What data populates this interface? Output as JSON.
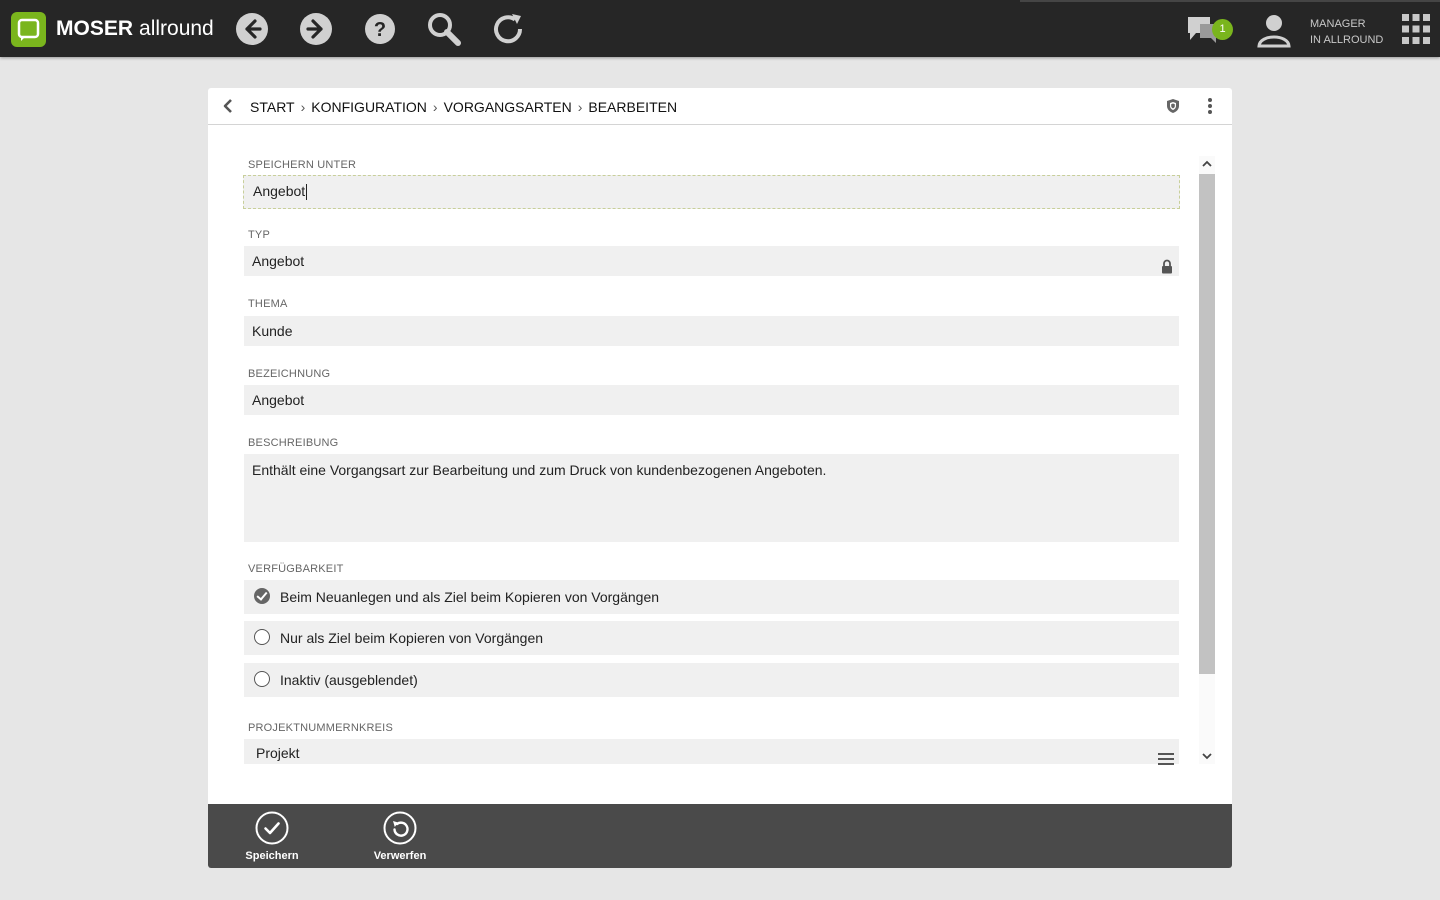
{
  "app": {
    "brand_bold": "MOSER",
    "brand_light": "allround",
    "chat_badge": "1",
    "user_line1": "MANAGER",
    "user_line2": "IN ALLROUND",
    "accent": "#7ab51d"
  },
  "breadcrumb": [
    "START",
    "KONFIGURATION",
    "VORGANGSARTEN",
    "BEARBEITEN"
  ],
  "breadcrumb_sep": "›",
  "form": {
    "speichern_unter": {
      "label": "SPEICHERN UNTER",
      "value": "Angebot"
    },
    "typ": {
      "label": "TYP",
      "value": "Angebot",
      "icon": "lock-icon"
    },
    "thema": {
      "label": "THEMA",
      "value": "Kunde"
    },
    "bezeichnung": {
      "label": "BEZEICHNUNG",
      "value": "Angebot"
    },
    "beschreibung": {
      "label": "BESCHREIBUNG",
      "value": "Enthält eine Vorgangsart zur Bearbeitung und zum Druck von kundenbezogenen Angeboten."
    },
    "verfuegbarkeit": {
      "label": "VERFÜGBARKEIT",
      "options": [
        {
          "label": "Beim Neuanlegen und als Ziel beim Kopieren von Vorgängen",
          "checked": true
        },
        {
          "label": "Nur als Ziel beim Kopieren von Vorgängen",
          "checked": false
        },
        {
          "label": "Inaktiv (ausgeblendet)",
          "checked": false
        }
      ]
    },
    "projektnummernkreis": {
      "label": "PROJEKTNUMMERNKREIS",
      "value": "Projekt",
      "icon": "list-menu-icon"
    }
  },
  "actions": {
    "save_label": "Speichern",
    "discard_label": "Verwerfen"
  }
}
